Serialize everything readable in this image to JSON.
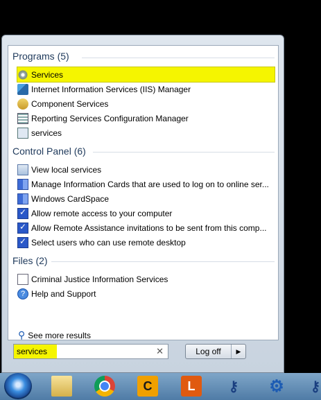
{
  "programs": {
    "title": "Programs (5)",
    "items": [
      {
        "label": "Services",
        "icon": "services-gear-icon"
      },
      {
        "label": "Internet Information Services (IIS) Manager",
        "icon": "iis-manager-icon"
      },
      {
        "label": "Component Services",
        "icon": "component-services-icon"
      },
      {
        "label": "Reporting Services Configuration Manager",
        "icon": "reporting-services-icon"
      },
      {
        "label": "services",
        "icon": "window-icon"
      }
    ]
  },
  "control_panel": {
    "title": "Control Panel (6)",
    "items": [
      {
        "label": "View local services",
        "icon": "view-services-icon"
      },
      {
        "label": "Manage Information Cards that are used to log on to online ser...",
        "icon": "cardspace-icon"
      },
      {
        "label": "Windows CardSpace",
        "icon": "cardspace-icon"
      },
      {
        "label": "Allow remote access to your computer",
        "icon": "system-check-icon"
      },
      {
        "label": "Allow Remote Assistance invitations to be sent from this comp...",
        "icon": "system-check-icon"
      },
      {
        "label": "Select users who can use remote desktop",
        "icon": "system-check-icon"
      }
    ]
  },
  "files": {
    "title": "Files (2)",
    "items": [
      {
        "label": "Criminal Justice Information Services",
        "icon": "document-icon"
      },
      {
        "label": "Help and Support",
        "icon": "help-icon"
      }
    ]
  },
  "see_more": "See more results",
  "search": {
    "value": "services",
    "clear": "✕"
  },
  "logoff": {
    "label": "Log off",
    "arrow": "▶"
  },
  "taskbar": {
    "c_label": "C",
    "l_label": "L",
    "keys_glyph": "⚷",
    "gear_glyph": "⚙"
  },
  "colors": {
    "highlight": "#f5f500",
    "section_title": "#1e395b"
  }
}
